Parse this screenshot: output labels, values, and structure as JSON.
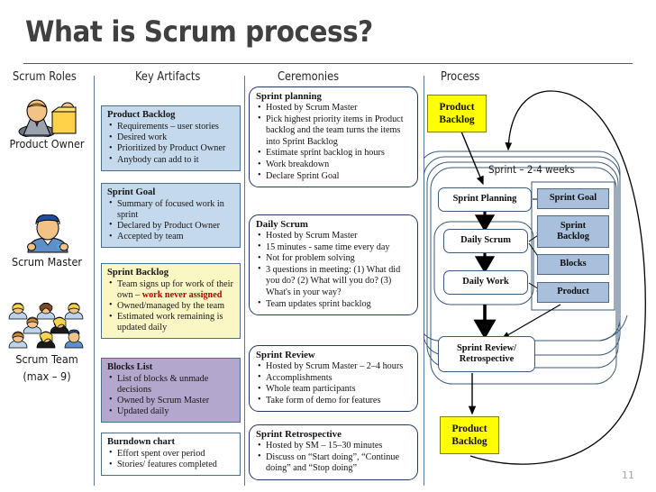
{
  "slide": {
    "title": "What is Scrum process?",
    "page_number": "11"
  },
  "columns": {
    "roles": "Scrum Roles",
    "artifacts": "Key Artifacts",
    "ceremonies": "Ceremonies",
    "process": "Process"
  },
  "roles": [
    {
      "icon": "product-owner-icon",
      "label": "Product Owner"
    },
    {
      "icon": "scrum-master-icon",
      "label": "Scrum Master"
    },
    {
      "icon": "scrum-team-icon",
      "label_line1": "Scrum Team",
      "label_line2": "(max – 9)"
    }
  ],
  "artifacts": [
    {
      "title": "Product Backlog",
      "color": "#c5d9ec",
      "items": [
        "Requirements – user stories",
        "Desired work",
        "Prioritized by Product Owner",
        "Anybody can add to it"
      ]
    },
    {
      "title": "Sprint Goal",
      "color": "#c5d9ec",
      "items": [
        "Summary of focused work in sprint",
        "Declared by Product Owner",
        "Accepted by team"
      ]
    },
    {
      "title": "Sprint Backlog",
      "color": "#fbf7c4",
      "items_html": [
        "Team signs up for work of their own – ",
        "Owned/managed by the team",
        "Estimated work remaining is updated daily"
      ],
      "highlight": "work never assigned"
    },
    {
      "title": "Blocks List",
      "color": "#b4a7cd",
      "items": [
        "List of blocks & unmade decisions",
        "Owned by Scrum Master",
        "Updated daily"
      ]
    },
    {
      "title": "Burndown chart",
      "color": "#ffffff",
      "items": [
        "Effort spent over period",
        "Stories/ features completed"
      ]
    }
  ],
  "ceremonies": [
    {
      "title": "Sprint planning",
      "items": [
        "Hosted by Scrum Master",
        "Pick highest priority items in Product backlog and the team turns the items into Sprint Backlog",
        "Estimate sprint backlog in hours",
        "Work breakdown",
        "Declare Sprint Goal"
      ]
    },
    {
      "title": "Daily Scrum",
      "items": [
        "Hosted by Scrum Master",
        "15 minutes - same time every day",
        "Not for problem solving",
        "3 questions in meeting: (1) What did you do? (2) What will you do? (3) What's in your way?",
        "Team updates sprint backlog"
      ]
    },
    {
      "title": "Sprint Review",
      "items": [
        "Hosted by Scrum Master – 2–4 hours",
        "Accomplishments",
        "Whole team participants",
        "Take form of demo for features"
      ]
    },
    {
      "title": "Sprint Retrospective",
      "items": [
        "Hosted by SM – 15–30 minutes",
        "Discuss on “Start doing”, “Continue doing” and “Stop doing”"
      ]
    }
  ],
  "process": {
    "sprint_label": "Sprint – 2-4 weeks",
    "product_backlog_top_line1": "Product",
    "product_backlog_top_line2": "Backlog",
    "product_backlog_bottom_line1": "Product",
    "product_backlog_bottom_line2": "Backlog",
    "flow_nodes": {
      "sprint_planning": "Sprint Planning",
      "daily_scrum": "Daily Scrum",
      "daily_work": "Daily Work",
      "review_retro_line1": "Sprint Review/",
      "review_retro_line2": "Retrospective"
    },
    "artifact_nodes": {
      "sprint_goal": "Sprint Goal",
      "sprint_backlog_line1": "Sprint",
      "sprint_backlog_line2": "Backlog",
      "blocks": "Blocks",
      "product": "Product"
    },
    "colors": {
      "sticky": "#ffff00",
      "artifact_box": "#a9c0dd",
      "flow_box": "#ffffff"
    }
  }
}
